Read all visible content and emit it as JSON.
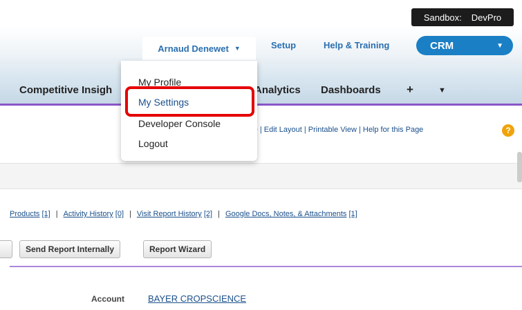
{
  "sandbox": {
    "label": "Sandbox:",
    "name": "DevPro"
  },
  "header": {
    "user_name": "Arnaud Denewet",
    "links": [
      "Setup",
      "Help & Training"
    ],
    "app": "CRM"
  },
  "tabs": [
    "Competitive Insigh",
    "Analytics",
    "Dashboards",
    "+"
  ],
  "user_menu": {
    "items": [
      "My Profile",
      "My Settings",
      "Developer Console",
      "Logout"
    ],
    "highlighted": "My Settings"
  },
  "page_links": "ize Page | Edit Layout | Printable View | Help for this Page",
  "related": [
    {
      "label": "Products",
      "count": "[1]"
    },
    {
      "label": "Activity History",
      "count": "[0]"
    },
    {
      "label": "Visit Report History",
      "count": "[2]"
    },
    {
      "label": "Google Docs, Notes, & Attachments",
      "count": "[1]"
    }
  ],
  "buttons": [
    "Send Report Internally",
    "Report Wizard"
  ],
  "account": {
    "label": "Account",
    "value": "BAYER CROPSCIENCE"
  },
  "colors": {
    "accent": "#1a7fc5",
    "highlight": "#e60000",
    "divider": "#8a56c8",
    "help": "#f0a30a"
  }
}
